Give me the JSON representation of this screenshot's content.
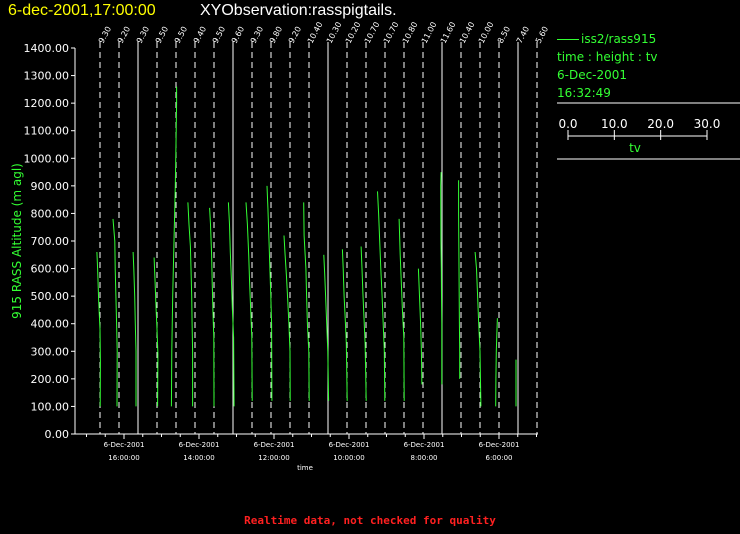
{
  "header": {
    "datetime": "6-dec-2001,17:00:00",
    "title": "XYObservation:rasspigtails."
  },
  "legend": {
    "instrument": "iss2/rass915",
    "axes_desc": "time : height : tv",
    "date": "6-Dec-2001",
    "time": "16:32:49",
    "scale_ticks": [
      "0.0",
      "10.0",
      "20.0",
      "30.0"
    ],
    "scale_label": "tv"
  },
  "footer": {
    "warning": "Realtime data, not checked for quality"
  },
  "colors": {
    "trace": "#33ff33",
    "axes": "#ffffff",
    "ylabel": "#33ff33",
    "title_date": "#ffff00",
    "warning": "#ff2020"
  },
  "chart_data": {
    "type": "line",
    "ylabel": "915 RASS Altitude (m agl)",
    "xlabel": "time",
    "ylim": [
      0,
      1400
    ],
    "yticks": [
      "0.00",
      "100.00",
      "200.00",
      "300.00",
      "400.00",
      "500.00",
      "600.00",
      "700.00",
      "800.00",
      "900.00",
      "1000.00",
      "1100.00",
      "1200.00",
      "1300.00",
      "1400.00"
    ],
    "xticks": [
      {
        "date": "6-Dec-2001",
        "time": "16:00:00"
      },
      {
        "date": "6-Dec-2001",
        "time": "14:00:00"
      },
      {
        "date": "6-Dec-2001",
        "time": "12:00:00"
      },
      {
        "date": "6-Dec-2001",
        "time": "10:00:00"
      },
      {
        "date": "6-Dec-2001",
        "time": "8:00:00"
      },
      {
        "date": "6-Dec-2001",
        "time": "6:00:00"
      }
    ],
    "profile_labels": [
      "9.30",
      "9.20",
      "9.30",
      "9.50",
      "9.50",
      "9.40",
      "9.50",
      "9.60",
      "9.30",
      "9.80",
      "9.20",
      "10.40",
      "10.30",
      "10.20",
      "10.70",
      "10.70",
      "10.80",
      "11.00",
      "11.60",
      "10.40",
      "10.00",
      "8.50",
      "7.40",
      "5.60"
    ],
    "series": [
      {
        "heights": [
          660,
          600,
          480,
          380,
          260,
          100
        ],
        "tv": [
          -0.5,
          -0.2,
          0.3,
          0.9,
          1.1,
          1.0
        ]
      },
      {
        "heights": [
          780,
          700,
          600,
          500,
          400,
          300,
          100
        ],
        "tv": [
          -1.8,
          -1.0,
          -0.8,
          -0.5,
          -0.2,
          0.1,
          0.0
        ]
      },
      {
        "heights": [
          660,
          600,
          500,
          400,
          300,
          100
        ],
        "tv": [
          -1.3,
          -1.0,
          -0.6,
          -0.3,
          0.0,
          0.0
        ]
      },
      {
        "heights": [
          640,
          560,
          470,
          380,
          290,
          100
        ],
        "tv": [
          -0.4,
          0.0,
          0.4,
          0.9,
          1.3,
          1.2
        ]
      },
      {
        "heights": [
          1260,
          1200,
          1100,
          900,
          700,
          500,
          300,
          100
        ],
        "tv": [
          1.2,
          1.2,
          1.0,
          0.6,
          0.0,
          -0.6,
          -1.0,
          -1.2
        ]
      },
      {
        "heights": [
          840,
          760,
          680,
          600,
          500,
          400,
          300,
          100
        ],
        "tv": [
          -2.3,
          -1.8,
          -1.2,
          -0.9,
          -0.6,
          -0.4,
          -0.2,
          -0.2
        ]
      },
      {
        "heights": [
          820,
          760,
          650,
          550,
          450,
          350,
          100
        ],
        "tv": [
          -1.1,
          -0.7,
          -0.2,
          0.1,
          0.4,
          0.8,
          0.9
        ]
      },
      {
        "heights": [
          840,
          760,
          660,
          560,
          460,
          350,
          100
        ],
        "tv": [
          -1.2,
          -0.7,
          -0.3,
          0.2,
          0.6,
          1.2,
          1.4
        ]
      },
      {
        "heights": [
          840,
          760,
          650,
          550,
          450,
          350,
          120
        ],
        "tv": [
          -1.8,
          -1.2,
          -0.6,
          -0.2,
          0.3,
          0.8,
          1.0
        ]
      },
      {
        "heights": [
          900,
          820,
          700,
          600,
          500,
          400,
          120
        ],
        "tv": [
          -0.9,
          -0.5,
          0.0,
          0.4,
          0.8,
          1.2,
          1.3
        ]
      },
      {
        "heights": [
          720,
          650,
          570,
          480,
          400,
          300,
          120
        ],
        "tv": [
          -1.8,
          -1.3,
          -0.7,
          -0.1,
          0.4,
          0.9,
          1.0
        ]
      },
      {
        "heights": [
          840,
          720,
          600,
          500,
          400,
          300,
          120
        ],
        "tv": [
          -1.5,
          -1.3,
          -0.5,
          -0.2,
          0.2,
          0.8,
          1.0
        ]
      },
      {
        "heights": [
          650,
          580,
          500,
          400,
          300,
          120
        ],
        "tv": [
          -1.0,
          -0.6,
          -0.2,
          0.3,
          0.8,
          1.2
        ]
      },
      {
        "heights": [
          670,
          600,
          500,
          420,
          330,
          120
        ],
        "tv": [
          -1.2,
          -0.8,
          -0.4,
          0.1,
          0.6,
          1.0
        ]
      },
      {
        "heights": [
          680,
          600,
          510,
          420,
          330,
          120
        ],
        "tv": [
          -1.3,
          -0.9,
          -0.5,
          0.0,
          0.5,
          1.0
        ]
      },
      {
        "heights": [
          880,
          800,
          700,
          600,
          500,
          400,
          300,
          120
        ],
        "tv": [
          -2.5,
          -2.0,
          -1.5,
          -1.0,
          -0.4,
          0.1,
          0.6,
          0.8
        ]
      },
      {
        "heights": [
          780,
          650,
          550,
          450,
          350,
          120
        ],
        "tv": [
          -1.3,
          -0.8,
          -0.3,
          0.2,
          0.8,
          1.0
        ]
      },
      {
        "heights": [
          600,
          500,
          400,
          300,
          180
        ],
        "tv": [
          -1.2,
          -0.7,
          -0.2,
          0.2,
          0.4
        ]
      },
      {
        "heights": [
          950,
          900,
          700,
          600,
          500,
          400,
          300,
          180
        ],
        "tv": [
          0.5,
          0.3,
          0.4,
          0.6,
          0.7,
          0.8,
          0.8,
          0.8
        ]
      },
      {
        "heights": [
          920,
          800,
          700,
          600,
          500,
          400,
          300,
          200
        ],
        "tv": [
          -0.2,
          -0.2,
          -0.1,
          0.0,
          0.1,
          0.2,
          0.3,
          0.3
        ]
      },
      {
        "heights": [
          660,
          600,
          500,
          400,
          300,
          100
        ],
        "tv": [
          -1.3,
          -0.7,
          -0.2,
          0.3,
          0.9,
          1.3
        ]
      },
      {
        "heights": [
          420,
          380,
          300,
          200,
          100
        ],
        "tv": [
          0.2,
          0.0,
          -0.3,
          -0.5,
          -0.6
        ]
      },
      {
        "heights": [
          270,
          200,
          100
        ],
        "tv": [
          0.0,
          0.0,
          0.0
        ]
      }
    ]
  }
}
